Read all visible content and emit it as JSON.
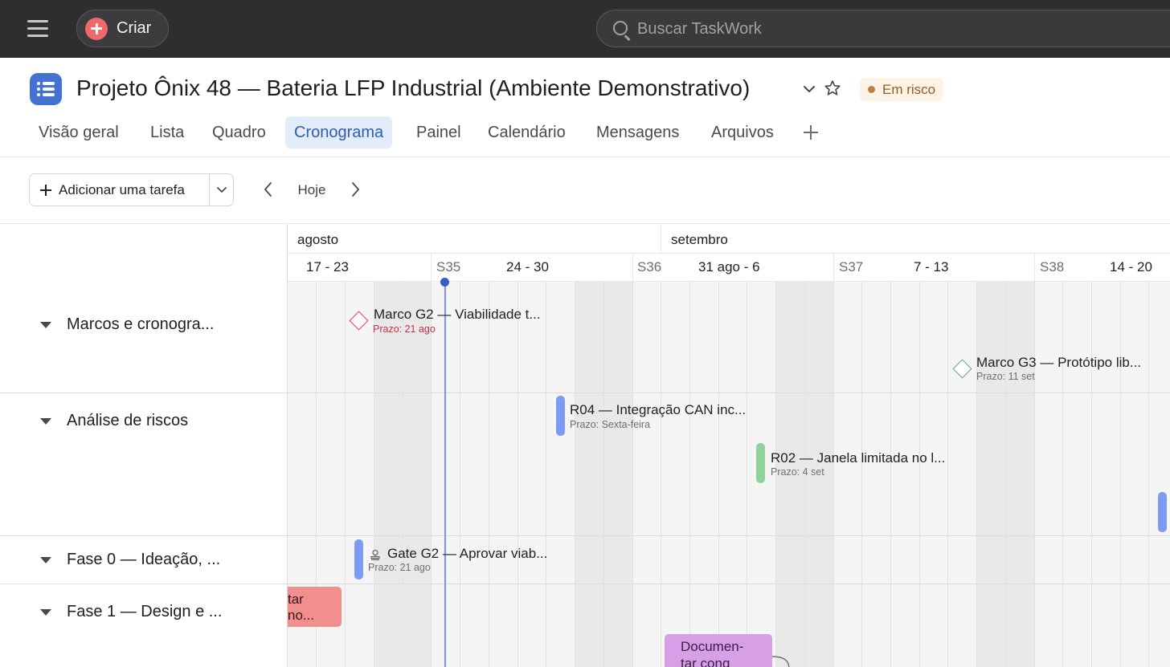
{
  "topbar": {
    "create_label": "Criar",
    "search_placeholder": "Buscar TaskWork",
    "icons": {
      "menu": "hamburger-icon",
      "create": "plus-circle-icon",
      "search": "search-icon"
    },
    "colors": {
      "bar_bg": "#2e2e30",
      "create_accent": "#f06a6a"
    }
  },
  "project": {
    "title": "Projeto Ônix 48 — Bateria LFP Industrial (Ambiente Demonstrativo)",
    "status": "Em risco",
    "status_color": "#c08140",
    "icon": "list-icon",
    "icon_color": "#4573d2"
  },
  "tabs": [
    {
      "label": "Visão geral",
      "active": false
    },
    {
      "label": "Lista",
      "active": false
    },
    {
      "label": "Quadro",
      "active": false
    },
    {
      "label": "Cronograma",
      "active": true
    },
    {
      "label": "Painel",
      "active": false
    },
    {
      "label": "Calendário",
      "active": false
    },
    {
      "label": "Mensagens",
      "active": false
    },
    {
      "label": "Arquivos",
      "active": false
    }
  ],
  "toolbar": {
    "add_task_label": "Adicionar uma tarefa",
    "today_label": "Hoje"
  },
  "timeline": {
    "months": [
      "agosto",
      "setembro"
    ],
    "weeks": [
      {
        "range": "17 - 23",
        "num": "S35"
      },
      {
        "range": "24 - 30",
        "num": "S36"
      },
      {
        "range": "31 ago - 6",
        "num": "S37"
      },
      {
        "range": "7 - 13",
        "num": "S38"
      },
      {
        "range": "14 - 20",
        "num": ""
      }
    ]
  },
  "sections": [
    {
      "title": "Marcos e cronogra..."
    },
    {
      "title": "Análise de riscos"
    },
    {
      "title": "Fase 0 — Ideação, ..."
    },
    {
      "title": "Fase 1 — Design e ..."
    }
  ],
  "tasks": {
    "g2_marco": {
      "title": "Marco G2 — Viabilidade t...",
      "due": "Prazo: 21 ago",
      "color": "#e8384f"
    },
    "g3_marco": {
      "title": "Marco G3 — Protótipo lib...",
      "due": "Prazo: 11 set",
      "color": "#5da283"
    },
    "r04": {
      "title": "R04 — Integração CAN inc...",
      "due": "Prazo: Sexta-feira",
      "color": "#7b9cf2"
    },
    "r02": {
      "title": "R02 — Janela limitada no l...",
      "due": "Prazo: 4 set",
      "color": "#8fd39b"
    },
    "gate_g2": {
      "title": "Gate G2 — Aprovar viab...",
      "due": "Prazo: 21 ago",
      "color": "#7b9cf2"
    },
    "red_block": {
      "line1": "tar",
      "line2": "no...",
      "color": "#f18e8e"
    },
    "doc_block": {
      "line1": "Documen-",
      "line2": "tar cong",
      "color": "#d79fe6"
    }
  }
}
